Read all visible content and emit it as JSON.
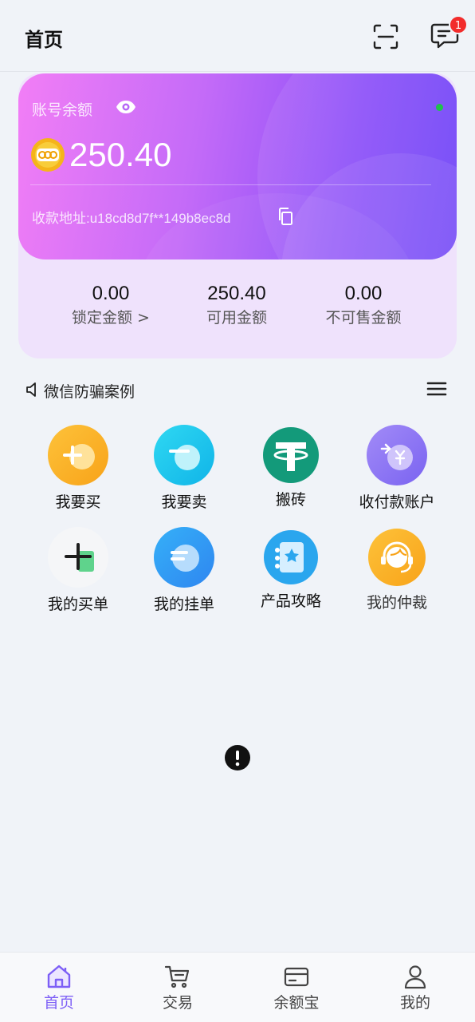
{
  "header": {
    "title": "首页",
    "scan_icon": "scan-icon",
    "message_icon": "message-icon",
    "message_badge": "1"
  },
  "balance_card": {
    "label": "账号余额",
    "amount": "250.40",
    "address_label": "收款地址:u18cd8d7f**149b8ec8d",
    "status_color": "#1fc24b"
  },
  "stats": [
    {
      "value": "0.00",
      "label": "锁定金额 >"
    },
    {
      "value": "250.40",
      "label": "可用金额"
    },
    {
      "value": "0.00",
      "label": "不可售金额"
    }
  ],
  "notice": {
    "text": "微信防骗案例"
  },
  "grid": [
    {
      "label": "我要买",
      "icon": "buy-icon",
      "color": "#fbb32a"
    },
    {
      "label": "我要卖",
      "icon": "sell-icon",
      "color": "#1ec5ec"
    },
    {
      "label": "搬砖",
      "icon": "tether-icon",
      "color": "#139a7a"
    },
    {
      "label": "收付款账户",
      "icon": "payment-account-icon",
      "color": "#8b74f4"
    },
    {
      "label": "我的买单",
      "icon": "my-buy-orders-icon",
      "color": "#f3f4f6"
    },
    {
      "label": "我的挂单",
      "icon": "my-listings-icon",
      "color": "#2f9af5"
    },
    {
      "label": "产品攻略",
      "icon": "guide-icon",
      "color": "#2aa6ee"
    },
    {
      "label": "我的仲裁",
      "icon": "arbitration-icon",
      "color": "#fbb32a"
    }
  ],
  "tabbar": [
    {
      "label": "首页",
      "icon": "home-icon",
      "active": true
    },
    {
      "label": "交易",
      "icon": "cart-icon",
      "active": false
    },
    {
      "label": "余额宝",
      "icon": "wallet-card-icon",
      "active": false
    },
    {
      "label": "我的",
      "icon": "profile-icon",
      "active": false
    }
  ],
  "colors": {
    "accent": "#7d5ff6",
    "card_start": "#f27ef6",
    "card_end": "#6d42f7"
  }
}
